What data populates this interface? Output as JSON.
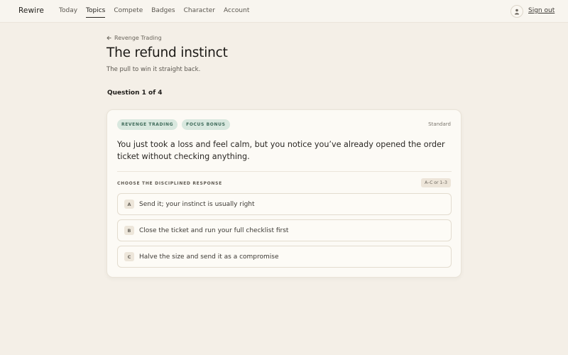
{
  "app": {
    "brand": "Rewire",
    "sign_out": "Sign out"
  },
  "nav": [
    {
      "label": "Today",
      "active": false
    },
    {
      "label": "Topics",
      "active": true
    },
    {
      "label": "Compete",
      "active": false
    },
    {
      "label": "Badges",
      "active": false
    },
    {
      "label": "Character",
      "active": false
    },
    {
      "label": "Account",
      "active": false
    }
  ],
  "header": {
    "breadcrumb": "Revenge Trading",
    "title": "The refund instinct",
    "subtitle": "The pull to win it straight back.",
    "question_count": "Question 1 of 4"
  },
  "card": {
    "tags": [
      "REVENGE TRADING",
      "FOCUS BONUS"
    ],
    "difficulty": "Standard",
    "prompt": "You just took a loss and feel calm, but you notice you’ve already opened the order ticket without checking anything.",
    "choose_label": "CHOOSE THE DISCIPLINED RESPONSE",
    "keys_hint": "A–C or 1–3",
    "options": [
      {
        "letter": "A",
        "text": "Send it; your instinct is usually right"
      },
      {
        "letter": "B",
        "text": "Close the ticket and run your full checklist first"
      },
      {
        "letter": "C",
        "text": "Halve the size and send it as a compromise"
      }
    ]
  },
  "colors": {
    "accent_tag_bg": "#d9e8df",
    "accent_tag_text": "#3f6b5a",
    "page_bg": "#f4efe7"
  },
  "icons": {
    "back": "arrow-left-icon",
    "avatar": "user-icon"
  }
}
